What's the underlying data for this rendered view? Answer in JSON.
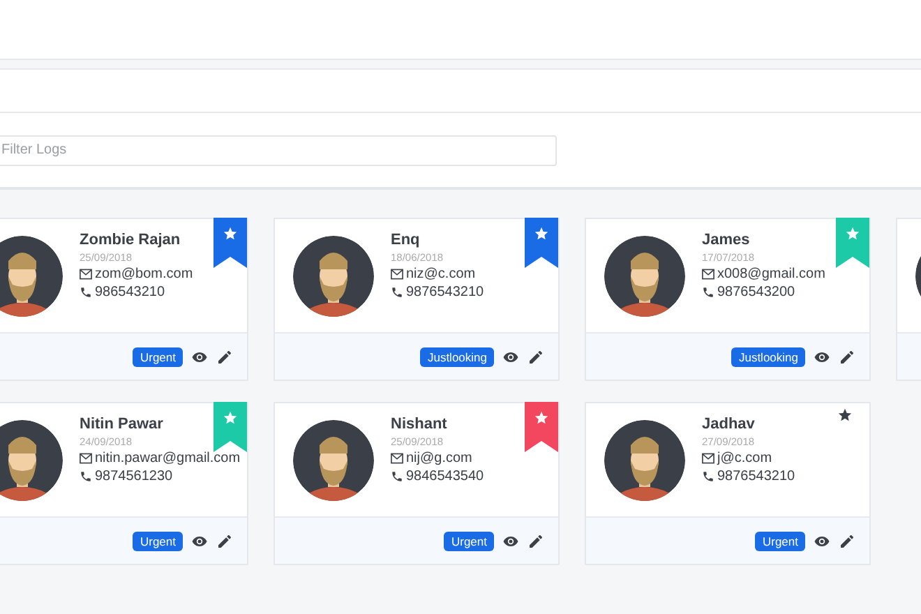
{
  "filter": {
    "placeholder": "Filter Logs"
  },
  "cards": [
    {
      "kind": "contact",
      "name": "Zombie Rajan",
      "date": "25/09/2018",
      "email": "zom@bom.com",
      "phone": "986543210",
      "tag": "Urgent",
      "badge": {
        "kind": "ribbon",
        "color": "#1a6be6"
      }
    },
    {
      "kind": "contact",
      "name": "Enq",
      "date": "18/06/2018",
      "email": "niz@c.com",
      "phone": "9876543210",
      "tag": "Justlooking",
      "badge": {
        "kind": "ribbon",
        "color": "#1a6be6"
      }
    },
    {
      "kind": "contact",
      "name": "James",
      "date": "17/07/2018",
      "email": "x008@gmail.com",
      "phone": "9876543200",
      "tag": "Justlooking",
      "badge": {
        "kind": "ribbon",
        "color": "#1ccaa8"
      }
    },
    {
      "kind": "cut_off"
    },
    {
      "kind": "contact",
      "name": "Nitin Pawar",
      "date": "24/09/2018",
      "email": "nitin.pawar@gmail.com",
      "phone": "9874561230",
      "tag": "Urgent",
      "badge": {
        "kind": "ribbon",
        "color": "#1ccaa8"
      }
    },
    {
      "kind": "contact",
      "name": "Nishant",
      "date": "25/09/2018",
      "email": "nij@g.com",
      "phone": "9846543540",
      "tag": "Urgent",
      "badge": {
        "kind": "ribbon",
        "color": "#f2475f"
      }
    },
    {
      "kind": "contact",
      "name": "Jadhav",
      "date": "27/09/2018",
      "email": "j@c.com",
      "phone": "9876543210",
      "tag": "Urgent",
      "badge": {
        "kind": "star",
        "color": "#3a3f4a"
      }
    }
  ]
}
